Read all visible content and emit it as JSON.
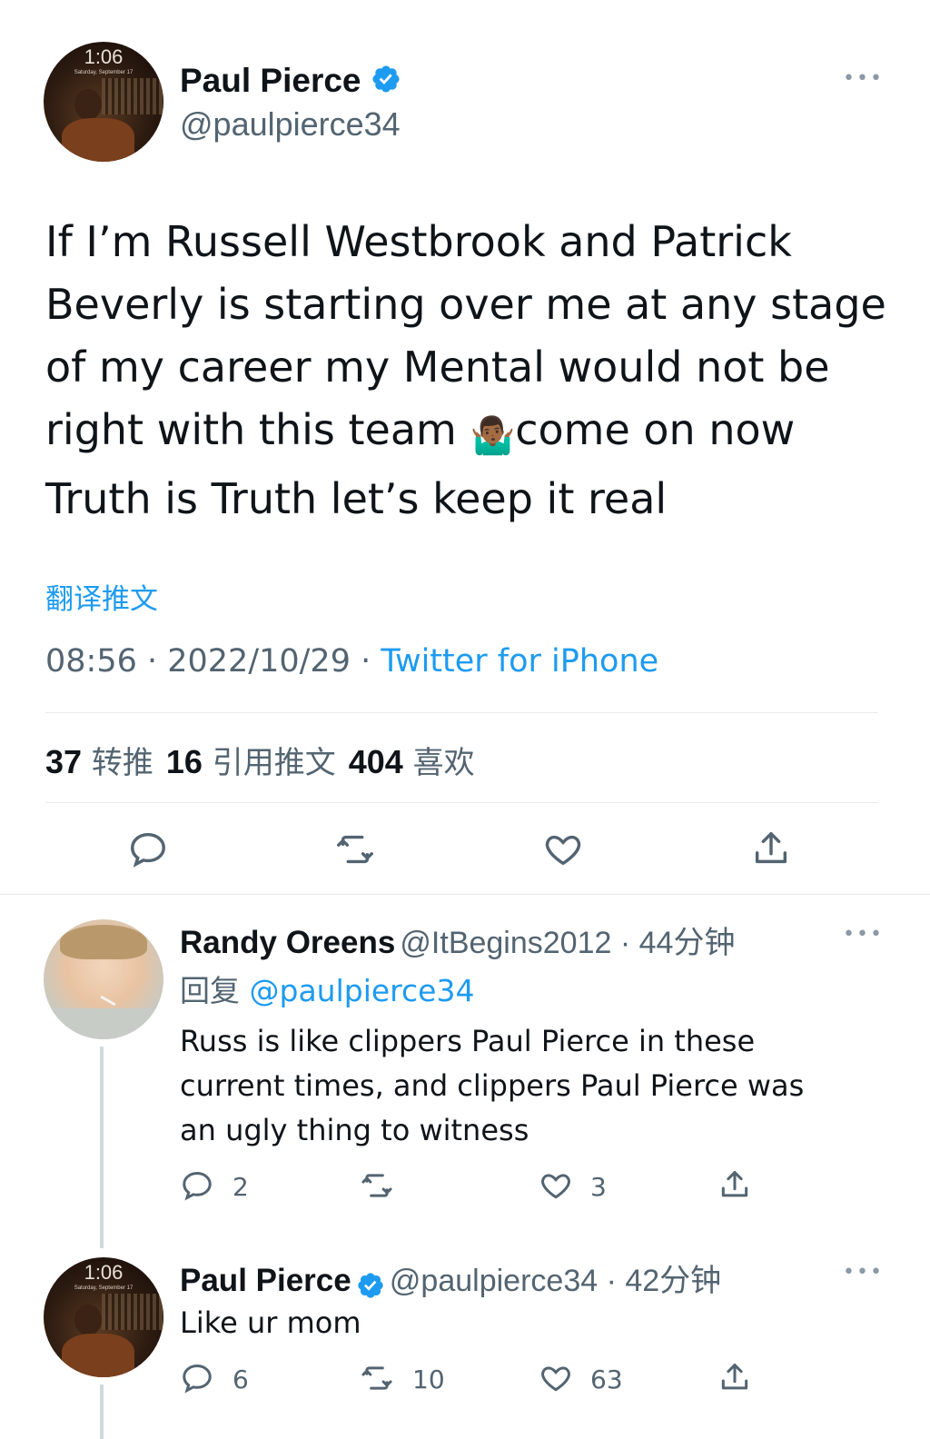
{
  "main_tweet": {
    "avatar": {
      "clock": "1:06",
      "date": "Saturday, September 17"
    },
    "name": "Paul Pierce",
    "handle": "@paulpierce34",
    "text_lines": [
      "If I’m Russell Westbrook and Patrick",
      "Beverly is starting over me at any stage",
      "of my career my Mental would not be",
      "right with this team ",
      "come on now",
      "Truth is Truth let’s keep it real"
    ],
    "emoji": "🤷🏾‍♂️",
    "translate": "翻译推文",
    "time": "08:56 · 2022/10/29 · ",
    "source": "Twitter for iPhone",
    "stats": {
      "retweets": "37",
      "retweets_label": "转推",
      "quotes": "16",
      "quotes_label": "引用推文",
      "likes": "404",
      "likes_label": "喜欢"
    }
  },
  "replies": [
    {
      "name": "Randy Oreens",
      "handle": "@ItBegins2012 · 44分钟",
      "reply_to_label": "回复 ",
      "reply_to_handle": "@paulpierce34",
      "text_lines": [
        "Russ is like clippers Paul Pierce in these",
        "current times, and clippers Paul Pierce was",
        "an ugly thing to witness"
      ],
      "replies": "2",
      "retweets": "",
      "likes": "3"
    },
    {
      "name": "Paul Pierce",
      "handle": "@paulpierce34 · 42分钟",
      "avatar": {
        "clock": "1:06",
        "date": "Saturday, September 17"
      },
      "text_lines": [
        "Like ur mom"
      ],
      "replies": "6",
      "retweets": "10",
      "likes": "63"
    }
  ],
  "colors": {
    "accent": "#1d9bf0",
    "text": "#0f1419",
    "secondary": "#536471",
    "divider": "#e6e9ec"
  }
}
